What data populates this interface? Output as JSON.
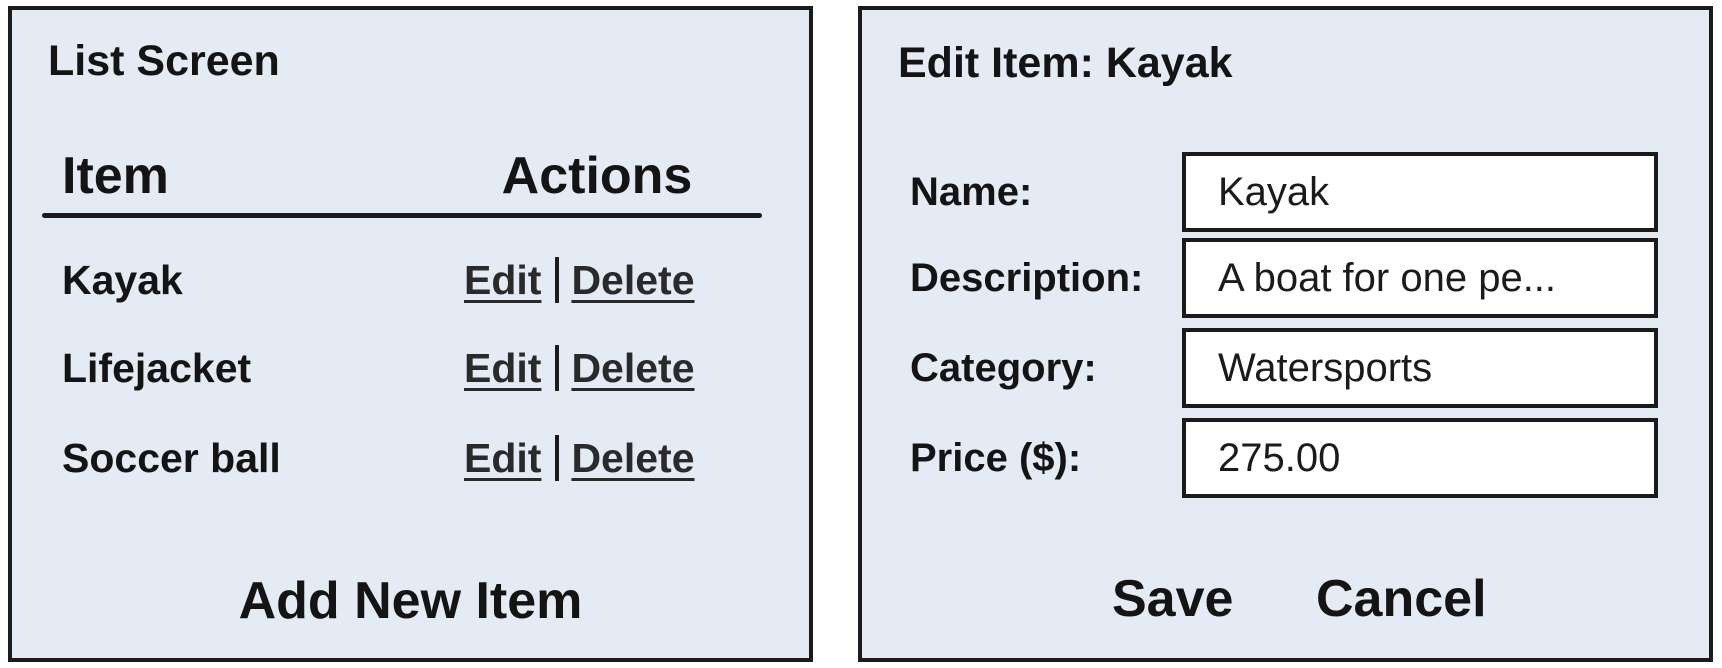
{
  "list_screen": {
    "title": "List Screen",
    "columns": {
      "item": "Item",
      "actions": "Actions"
    },
    "rows": [
      {
        "name": "Kayak",
        "edit": "Edit",
        "delete": "Delete"
      },
      {
        "name": "Lifejacket",
        "edit": "Edit",
        "delete": "Delete"
      },
      {
        "name": "Soccer ball",
        "edit": "Edit",
        "delete": "Delete"
      }
    ],
    "add_button": "Add New Item"
  },
  "edit_screen": {
    "title": "Edit Item: Kayak",
    "fields": [
      {
        "label": "Name:",
        "value": "Kayak"
      },
      {
        "label": "Description:",
        "value": "A boat for one pe..."
      },
      {
        "label": "Category:",
        "value": "Watersports"
      },
      {
        "label": "Price ($):",
        "value": "275.00"
      }
    ],
    "save_label": "Save",
    "cancel_label": "Cancel"
  },
  "colors": {
    "panel_background": "#e4ebf4",
    "border": "#1b1b1b",
    "input_background": "#ffffff"
  }
}
